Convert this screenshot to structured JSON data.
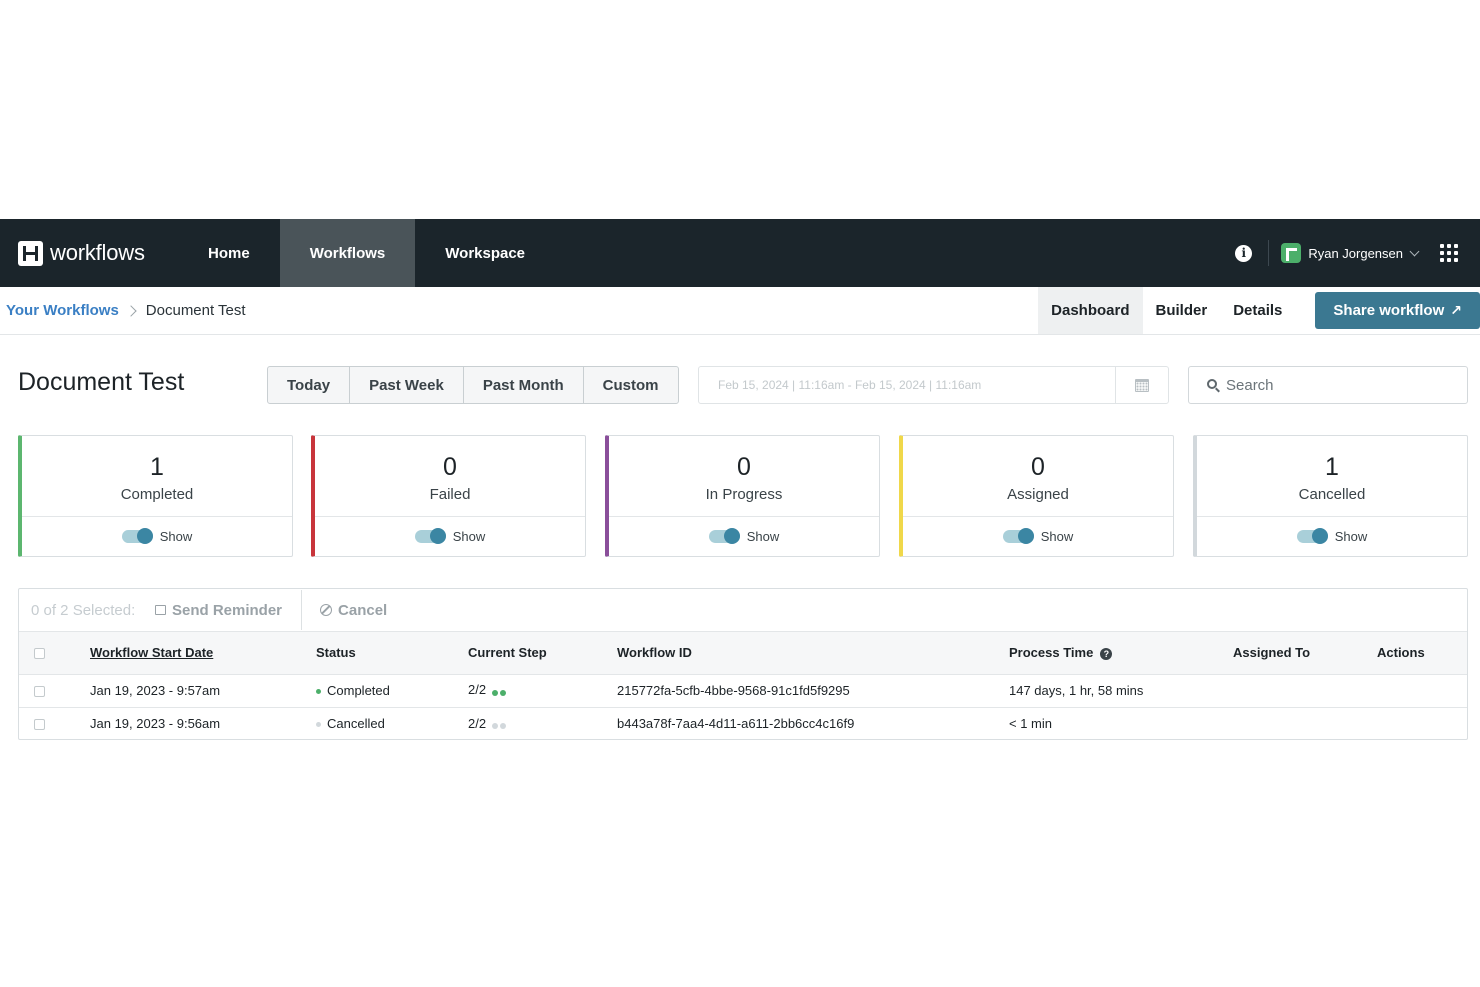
{
  "brand": {
    "name": "workflows"
  },
  "nav": {
    "items": [
      {
        "label": "Home"
      },
      {
        "label": "Workflows"
      },
      {
        "label": "Workspace"
      }
    ],
    "user": "Ryan Jorgensen"
  },
  "breadcrumb": {
    "root": "Your Workflows",
    "current": "Document Test"
  },
  "subtabs": [
    {
      "label": "Dashboard"
    },
    {
      "label": "Builder"
    },
    {
      "label": "Details"
    }
  ],
  "share_label": "Share workflow",
  "page_title": "Document Test",
  "ranges": [
    "Today",
    "Past Week",
    "Past Month",
    "Custom"
  ],
  "date_range_placeholder": "Feb 15, 2024 | 11:16am - Feb 15, 2024 | 11:16am",
  "search": {
    "placeholder": "Search"
  },
  "toggle_label": "Show",
  "stats": [
    {
      "count": "1",
      "label": "Completed",
      "color": "#5cb66f"
    },
    {
      "count": "0",
      "label": "Failed",
      "color": "#c8353b"
    },
    {
      "count": "0",
      "label": "In Progress",
      "color": "#8a4f9a"
    },
    {
      "count": "0",
      "label": "Assigned",
      "color": "#f0d84a"
    },
    {
      "count": "1",
      "label": "Cancelled",
      "color": "#d2d8dc"
    }
  ],
  "toolbar": {
    "selected": "0 of 2 Selected:",
    "send_reminder": "Send Reminder",
    "cancel": "Cancel"
  },
  "table": {
    "headers": {
      "start_date": "Workflow Start Date",
      "status": "Status",
      "current_step": "Current Step",
      "workflow_id": "Workflow ID",
      "process_time": "Process Time",
      "assigned_to": "Assigned To",
      "actions": "Actions"
    },
    "rows": [
      {
        "start_date": "Jan 19, 2023 - 9:57am",
        "status": "Completed",
        "status_color": "#4caf6a",
        "step": "2/2",
        "step_color": "#4caf6a",
        "workflow_id": "215772fa-5cfb-4bbe-9568-91c1fd5f9295",
        "process_time": "147 days, 1 hr, 58 mins",
        "assigned_to": ""
      },
      {
        "start_date": "Jan 19, 2023 - 9:56am",
        "status": "Cancelled",
        "status_color": "#d2d8dc",
        "step": "2/2",
        "step_color": "#d2d8dc",
        "workflow_id": "b443a78f-7aa4-4d11-a611-2bb6cc4c16f9",
        "process_time": "< 1 min",
        "assigned_to": ""
      }
    ]
  }
}
